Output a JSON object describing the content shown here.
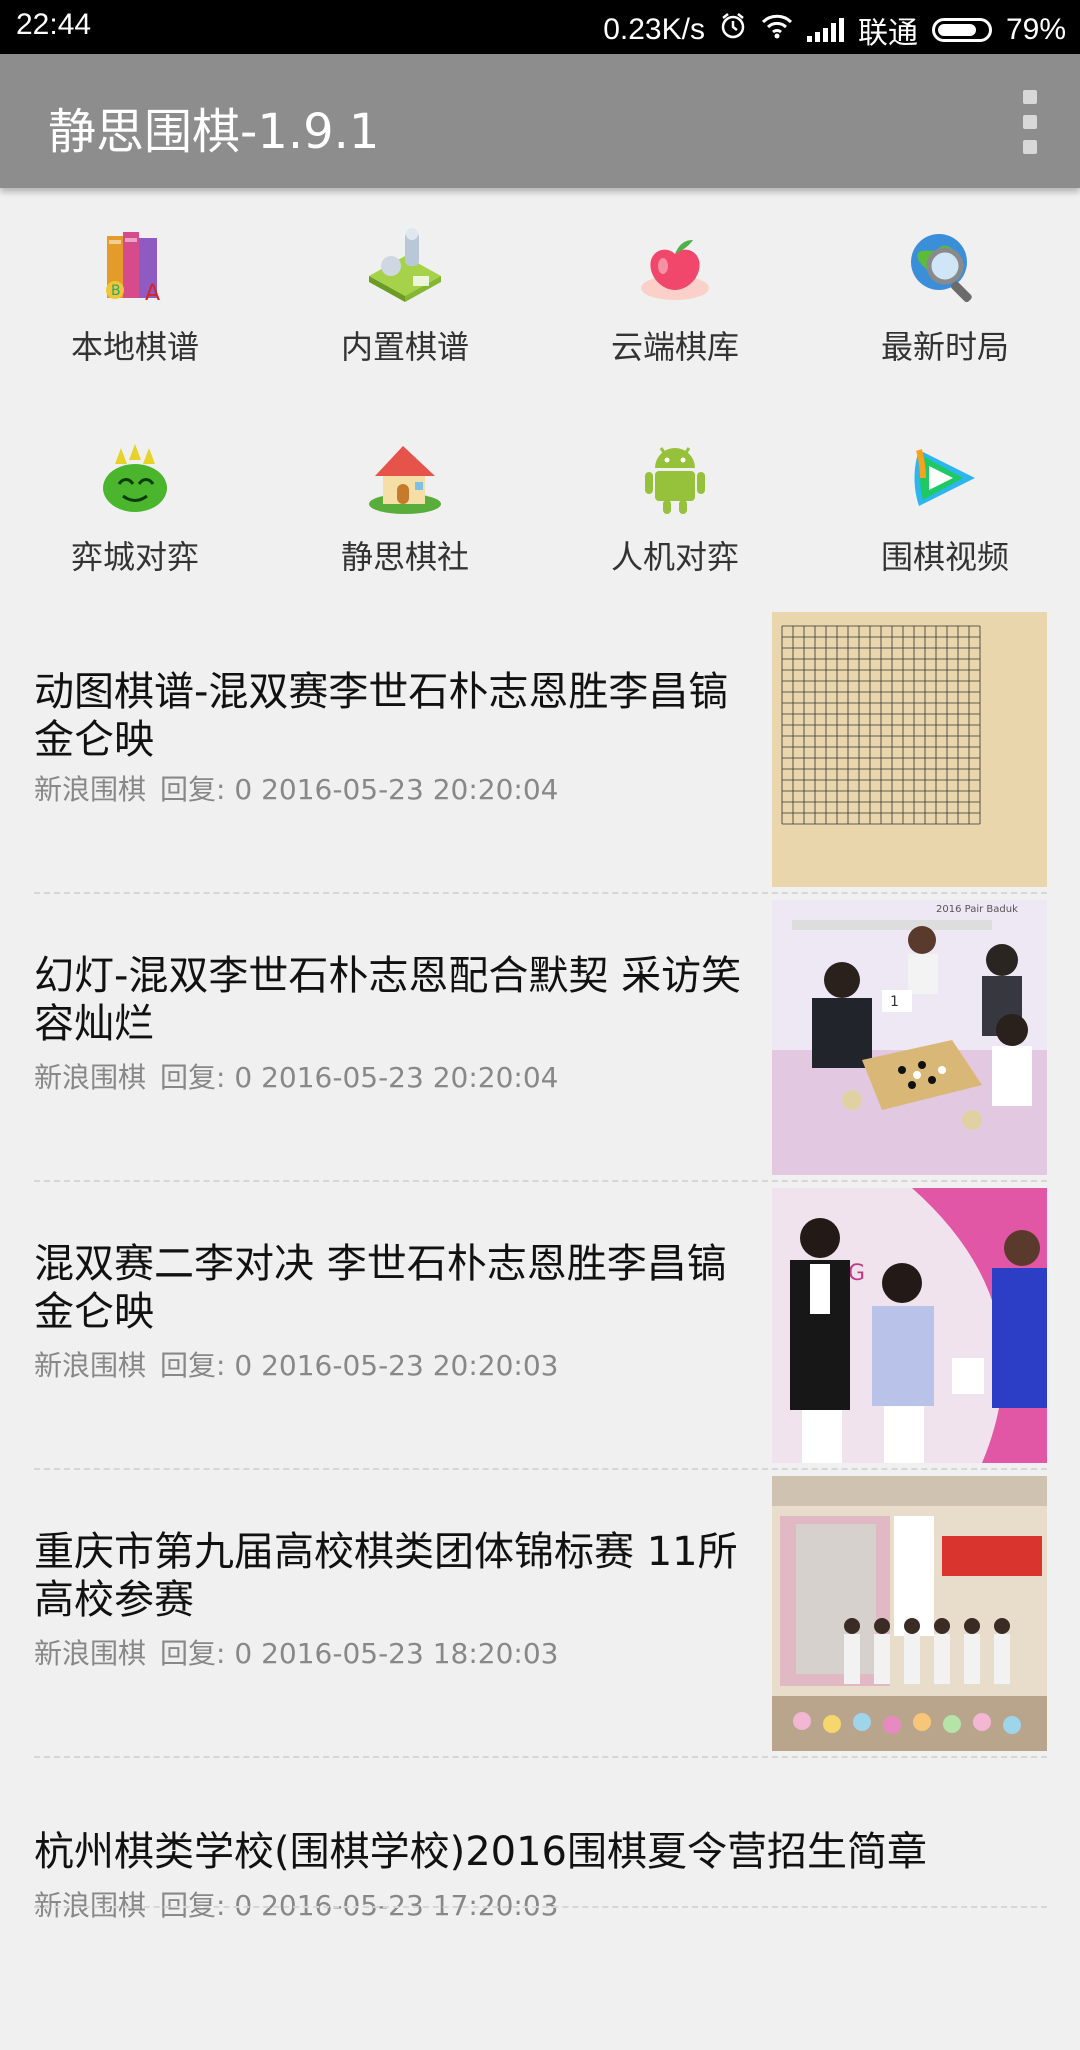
{
  "status": {
    "time": "22:44",
    "speed": "0.23K/s",
    "carrier": "联通",
    "battery": "79%",
    "battery_level": 0.79
  },
  "app": {
    "title": "静思围棋-1.9.1"
  },
  "grid": [
    {
      "label": "本地棋谱",
      "icon": "books-icon"
    },
    {
      "label": "内置棋谱",
      "icon": "board-icon"
    },
    {
      "label": "云端棋库",
      "icon": "apple-hand-icon"
    },
    {
      "label": "最新时局",
      "icon": "globe-search-icon"
    },
    {
      "label": "弈城对弈",
      "icon": "dragon-icon"
    },
    {
      "label": "静思棋社",
      "icon": "house-icon"
    },
    {
      "label": "人机对弈",
      "icon": "android-icon"
    },
    {
      "label": "围棋视频",
      "icon": "play-icon"
    }
  ],
  "news": [
    {
      "title": "动图棋谱-混双赛李世石朴志恩胜李昌镐金仑映",
      "source": "新浪围棋",
      "replies": "回复: 0",
      "date": "2016-05-23 20:20:04",
      "thumb": "go-board"
    },
    {
      "title": "幻灯-混双李世石朴志恩配合默契 采访笑容灿烂",
      "source": "新浪围棋",
      "replies": "回复: 0",
      "date": "2016-05-23 20:20:04",
      "thumb": "photo-players",
      "thumb_caption": "2016 Pair Baduk"
    },
    {
      "title": "混双赛二李对决 李世石朴志恩胜李昌镐金仑映",
      "source": "新浪围棋",
      "replies": "回复: 0",
      "date": "2016-05-23 20:20:03",
      "thumb": "photo-interview",
      "thumb_caption": "SG"
    },
    {
      "title": "重庆市第九届高校棋类团体锦标赛 11所高校参赛",
      "source": "新浪围棋",
      "replies": "回复: 0",
      "date": "2016-05-23 18:20:03",
      "thumb": "photo-ceremony"
    },
    {
      "title": "杭州棋类学校(围棋学校)2016围棋夏令营招生简章",
      "source": "新浪围棋",
      "replies": "回复: 0",
      "date": "2016-05-23 17:20:03",
      "thumb": ""
    }
  ]
}
